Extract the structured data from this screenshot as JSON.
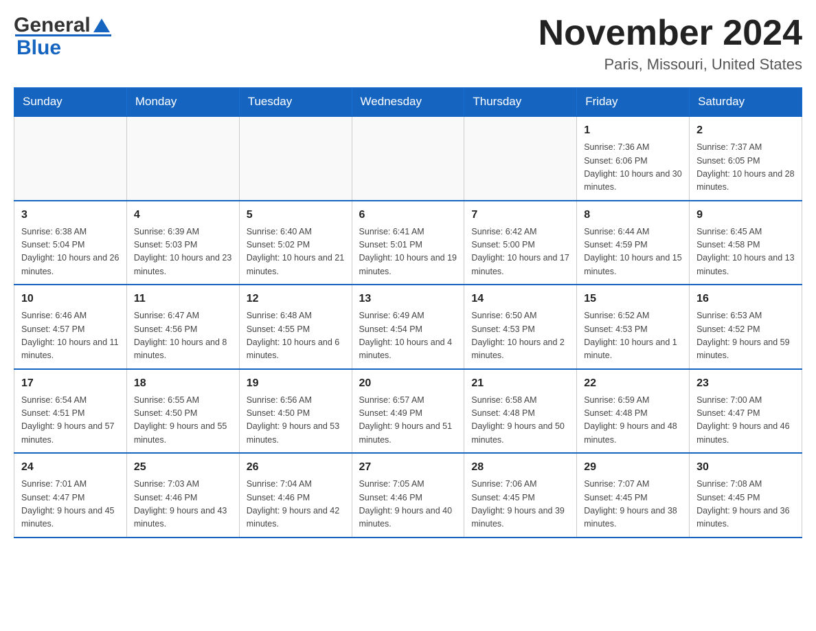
{
  "header": {
    "logo": {
      "general": "General",
      "blue": "Blue"
    },
    "title": "November 2024",
    "location": "Paris, Missouri, United States"
  },
  "weekdays": [
    "Sunday",
    "Monday",
    "Tuesday",
    "Wednesday",
    "Thursday",
    "Friday",
    "Saturday"
  ],
  "weeks": [
    [
      {
        "day": "",
        "sunrise": "",
        "sunset": "",
        "daylight": ""
      },
      {
        "day": "",
        "sunrise": "",
        "sunset": "",
        "daylight": ""
      },
      {
        "day": "",
        "sunrise": "",
        "sunset": "",
        "daylight": ""
      },
      {
        "day": "",
        "sunrise": "",
        "sunset": "",
        "daylight": ""
      },
      {
        "day": "",
        "sunrise": "",
        "sunset": "",
        "daylight": ""
      },
      {
        "day": "1",
        "sunrise": "Sunrise: 7:36 AM",
        "sunset": "Sunset: 6:06 PM",
        "daylight": "Daylight: 10 hours and 30 minutes."
      },
      {
        "day": "2",
        "sunrise": "Sunrise: 7:37 AM",
        "sunset": "Sunset: 6:05 PM",
        "daylight": "Daylight: 10 hours and 28 minutes."
      }
    ],
    [
      {
        "day": "3",
        "sunrise": "Sunrise: 6:38 AM",
        "sunset": "Sunset: 5:04 PM",
        "daylight": "Daylight: 10 hours and 26 minutes."
      },
      {
        "day": "4",
        "sunrise": "Sunrise: 6:39 AM",
        "sunset": "Sunset: 5:03 PM",
        "daylight": "Daylight: 10 hours and 23 minutes."
      },
      {
        "day": "5",
        "sunrise": "Sunrise: 6:40 AM",
        "sunset": "Sunset: 5:02 PM",
        "daylight": "Daylight: 10 hours and 21 minutes."
      },
      {
        "day": "6",
        "sunrise": "Sunrise: 6:41 AM",
        "sunset": "Sunset: 5:01 PM",
        "daylight": "Daylight: 10 hours and 19 minutes."
      },
      {
        "day": "7",
        "sunrise": "Sunrise: 6:42 AM",
        "sunset": "Sunset: 5:00 PM",
        "daylight": "Daylight: 10 hours and 17 minutes."
      },
      {
        "day": "8",
        "sunrise": "Sunrise: 6:44 AM",
        "sunset": "Sunset: 4:59 PM",
        "daylight": "Daylight: 10 hours and 15 minutes."
      },
      {
        "day": "9",
        "sunrise": "Sunrise: 6:45 AM",
        "sunset": "Sunset: 4:58 PM",
        "daylight": "Daylight: 10 hours and 13 minutes."
      }
    ],
    [
      {
        "day": "10",
        "sunrise": "Sunrise: 6:46 AM",
        "sunset": "Sunset: 4:57 PM",
        "daylight": "Daylight: 10 hours and 11 minutes."
      },
      {
        "day": "11",
        "sunrise": "Sunrise: 6:47 AM",
        "sunset": "Sunset: 4:56 PM",
        "daylight": "Daylight: 10 hours and 8 minutes."
      },
      {
        "day": "12",
        "sunrise": "Sunrise: 6:48 AM",
        "sunset": "Sunset: 4:55 PM",
        "daylight": "Daylight: 10 hours and 6 minutes."
      },
      {
        "day": "13",
        "sunrise": "Sunrise: 6:49 AM",
        "sunset": "Sunset: 4:54 PM",
        "daylight": "Daylight: 10 hours and 4 minutes."
      },
      {
        "day": "14",
        "sunrise": "Sunrise: 6:50 AM",
        "sunset": "Sunset: 4:53 PM",
        "daylight": "Daylight: 10 hours and 2 minutes."
      },
      {
        "day": "15",
        "sunrise": "Sunrise: 6:52 AM",
        "sunset": "Sunset: 4:53 PM",
        "daylight": "Daylight: 10 hours and 1 minute."
      },
      {
        "day": "16",
        "sunrise": "Sunrise: 6:53 AM",
        "sunset": "Sunset: 4:52 PM",
        "daylight": "Daylight: 9 hours and 59 minutes."
      }
    ],
    [
      {
        "day": "17",
        "sunrise": "Sunrise: 6:54 AM",
        "sunset": "Sunset: 4:51 PM",
        "daylight": "Daylight: 9 hours and 57 minutes."
      },
      {
        "day": "18",
        "sunrise": "Sunrise: 6:55 AM",
        "sunset": "Sunset: 4:50 PM",
        "daylight": "Daylight: 9 hours and 55 minutes."
      },
      {
        "day": "19",
        "sunrise": "Sunrise: 6:56 AM",
        "sunset": "Sunset: 4:50 PM",
        "daylight": "Daylight: 9 hours and 53 minutes."
      },
      {
        "day": "20",
        "sunrise": "Sunrise: 6:57 AM",
        "sunset": "Sunset: 4:49 PM",
        "daylight": "Daylight: 9 hours and 51 minutes."
      },
      {
        "day": "21",
        "sunrise": "Sunrise: 6:58 AM",
        "sunset": "Sunset: 4:48 PM",
        "daylight": "Daylight: 9 hours and 50 minutes."
      },
      {
        "day": "22",
        "sunrise": "Sunrise: 6:59 AM",
        "sunset": "Sunset: 4:48 PM",
        "daylight": "Daylight: 9 hours and 48 minutes."
      },
      {
        "day": "23",
        "sunrise": "Sunrise: 7:00 AM",
        "sunset": "Sunset: 4:47 PM",
        "daylight": "Daylight: 9 hours and 46 minutes."
      }
    ],
    [
      {
        "day": "24",
        "sunrise": "Sunrise: 7:01 AM",
        "sunset": "Sunset: 4:47 PM",
        "daylight": "Daylight: 9 hours and 45 minutes."
      },
      {
        "day": "25",
        "sunrise": "Sunrise: 7:03 AM",
        "sunset": "Sunset: 4:46 PM",
        "daylight": "Daylight: 9 hours and 43 minutes."
      },
      {
        "day": "26",
        "sunrise": "Sunrise: 7:04 AM",
        "sunset": "Sunset: 4:46 PM",
        "daylight": "Daylight: 9 hours and 42 minutes."
      },
      {
        "day": "27",
        "sunrise": "Sunrise: 7:05 AM",
        "sunset": "Sunset: 4:46 PM",
        "daylight": "Daylight: 9 hours and 40 minutes."
      },
      {
        "day": "28",
        "sunrise": "Sunrise: 7:06 AM",
        "sunset": "Sunset: 4:45 PM",
        "daylight": "Daylight: 9 hours and 39 minutes."
      },
      {
        "day": "29",
        "sunrise": "Sunrise: 7:07 AM",
        "sunset": "Sunset: 4:45 PM",
        "daylight": "Daylight: 9 hours and 38 minutes."
      },
      {
        "day": "30",
        "sunrise": "Sunrise: 7:08 AM",
        "sunset": "Sunset: 4:45 PM",
        "daylight": "Daylight: 9 hours and 36 minutes."
      }
    ]
  ]
}
